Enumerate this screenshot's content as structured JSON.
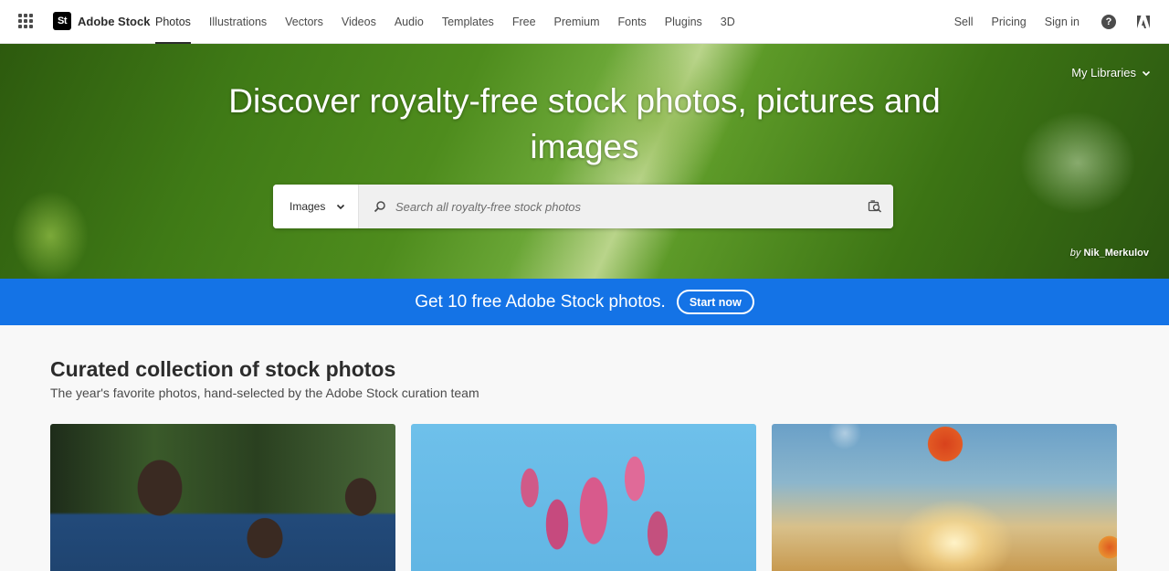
{
  "brand": {
    "logo_text": "St",
    "name": "Adobe Stock"
  },
  "nav": {
    "links": [
      "Photos",
      "Illustrations",
      "Vectors",
      "Videos",
      "Audio",
      "Templates",
      "Free",
      "Premium",
      "Fonts",
      "Plugins",
      "3D"
    ],
    "active": "Photos",
    "right": {
      "sell": "Sell",
      "pricing": "Pricing",
      "sign_in": "Sign in",
      "help_icon": "?"
    }
  },
  "hero": {
    "title": "Discover royalty-free stock photos, pictures and images",
    "my_libraries": "My Libraries",
    "search": {
      "type_selected": "Images",
      "placeholder": "Search all royalty-free stock photos",
      "value": ""
    },
    "credit": {
      "by": "by",
      "author": "Nik_Merkulov"
    }
  },
  "promo": {
    "text": "Get 10 free Adobe Stock photos.",
    "button": "Start now"
  },
  "curated": {
    "title": "Curated collection of stock photos",
    "subtitle": "The year's favorite photos, hand-selected by the Adobe Stock curation team"
  },
  "colors": {
    "accent_blue": "#1473e6",
    "text_dark": "#2c2c2c"
  }
}
